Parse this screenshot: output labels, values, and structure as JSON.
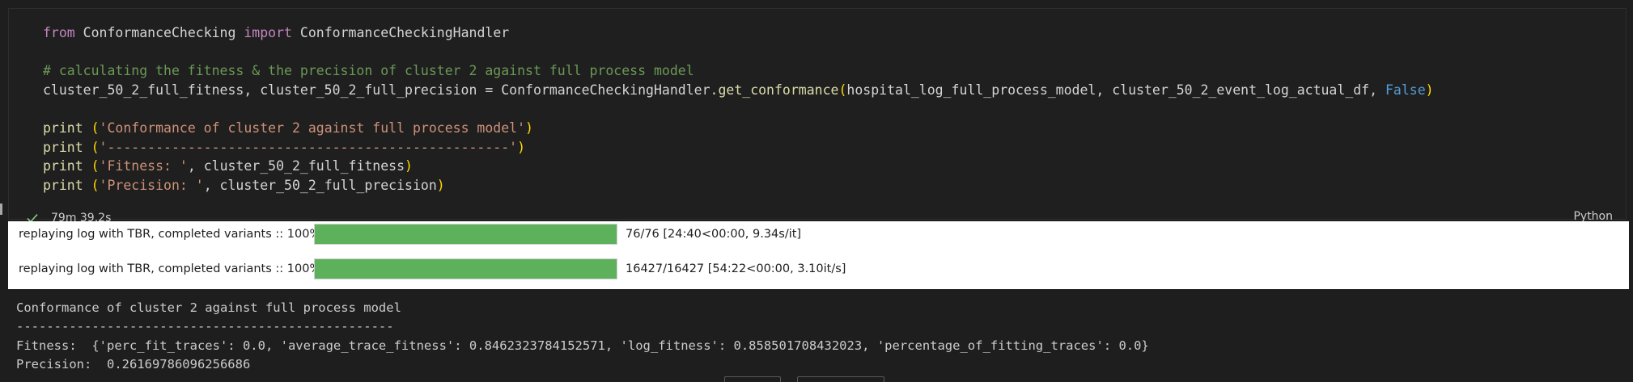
{
  "cell": {
    "code_lines": [
      [
        {
          "t": "kw",
          "v": "from"
        },
        {
          "t": "plain",
          "v": " ConformanceChecking "
        },
        {
          "t": "kw",
          "v": "import"
        },
        {
          "t": "plain",
          "v": " ConformanceCheckingHandler"
        }
      ],
      [],
      [
        {
          "t": "cm",
          "v": "# calculating the fitness & the precision of cluster 2 against full process model"
        }
      ],
      [
        {
          "t": "plain",
          "v": "cluster_50_2_full_fitness, cluster_50_2_full_precision = ConformanceCheckingHandler."
        },
        {
          "t": "fn",
          "v": "get_conformance"
        },
        {
          "t": "paren",
          "v": "("
        },
        {
          "t": "plain",
          "v": "hospital_log_full_process_model, cluster_50_2_event_log_actual_df, "
        },
        {
          "t": "bool",
          "v": "False"
        },
        {
          "t": "paren",
          "v": ")"
        }
      ],
      [],
      [
        {
          "t": "fn",
          "v": "print"
        },
        {
          "t": "plain",
          "v": " "
        },
        {
          "t": "paren",
          "v": "("
        },
        {
          "t": "str",
          "v": "'Conformance of cluster 2 against full process model'"
        },
        {
          "t": "paren",
          "v": ")"
        }
      ],
      [
        {
          "t": "fn",
          "v": "print"
        },
        {
          "t": "plain",
          "v": " "
        },
        {
          "t": "paren",
          "v": "("
        },
        {
          "t": "str",
          "v": "'--------------------------------------------------'"
        },
        {
          "t": "paren",
          "v": ")"
        }
      ],
      [
        {
          "t": "fn",
          "v": "print"
        },
        {
          "t": "plain",
          "v": " "
        },
        {
          "t": "paren",
          "v": "("
        },
        {
          "t": "str",
          "v": "'Fitness: '"
        },
        {
          "t": "plain",
          "v": ", cluster_50_2_full_fitness"
        },
        {
          "t": "paren",
          "v": ")"
        }
      ],
      [
        {
          "t": "fn",
          "v": "print"
        },
        {
          "t": "plain",
          "v": " "
        },
        {
          "t": "paren",
          "v": "("
        },
        {
          "t": "str",
          "v": "'Precision: '"
        },
        {
          "t": "plain",
          "v": ", cluster_50_2_full_precision"
        },
        {
          "t": "paren",
          "v": ")"
        }
      ]
    ],
    "execution_time": "79m 39.2s",
    "language": "Python",
    "status_icon": "check-icon",
    "colors": {
      "keyword": "#c586c0",
      "comment": "#6a9955",
      "string": "#ce9178",
      "function": "#dcdcaa",
      "boolean": "#569cd6",
      "success": "#89d185",
      "progress_fill": "#5cb15a"
    }
  },
  "progress_bars": [
    {
      "label": "replaying log with TBR, completed variants :: 100%",
      "progress": 1.0,
      "stats": "76/76 [24:40<00:00, 9.34s/it]"
    },
    {
      "label": "replaying log with TBR, completed variants :: 100%",
      "progress": 1.0,
      "stats": "16427/16427 [54:22<00:00, 3.10it/s]"
    }
  ],
  "text_output": [
    "Conformance of cluster 2 against full process model",
    "--------------------------------------------------",
    "Fitness:  {'perc_fit_traces': 0.0, 'average_trace_fitness': 0.8462323784152571, 'log_fitness': 0.858501708432023, 'percentage_of_fitting_traces': 0.0}",
    "Precision:  0.26169786096256686"
  ]
}
